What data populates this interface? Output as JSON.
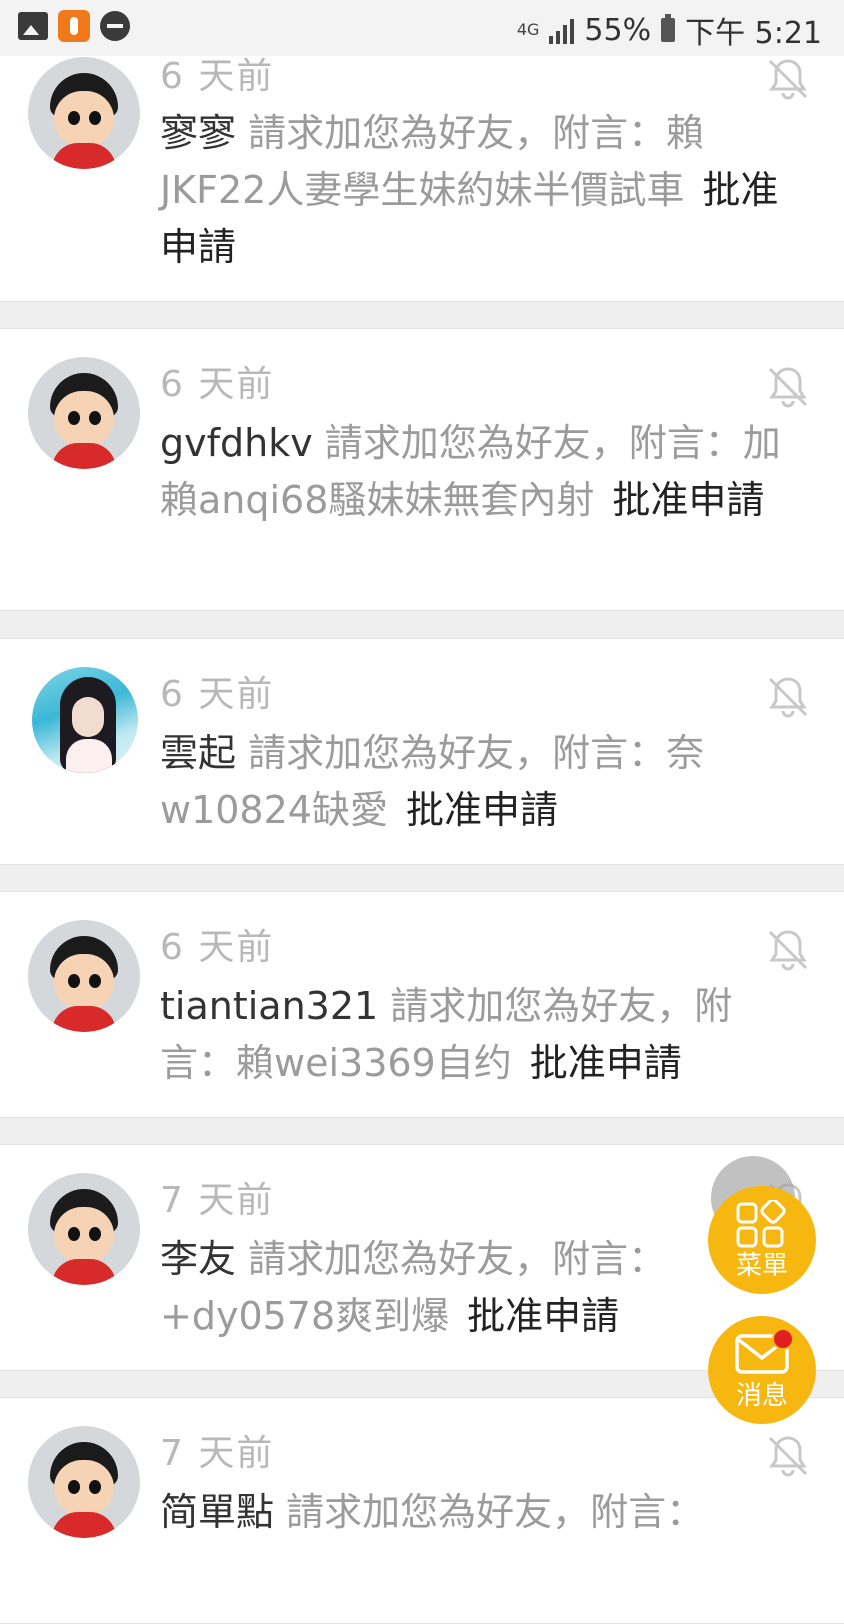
{
  "status_bar": {
    "network": "4G",
    "battery": "55%",
    "time": "下午 5:21"
  },
  "notifications": [
    {
      "time": "6 天前",
      "sender": "寥寥",
      "text": "請求加您為好友，附言：賴JKF22人妻學生妹約妹半價試車",
      "action": "批准申請",
      "avatar": "default-boy-avatar"
    },
    {
      "time": "6 天前",
      "sender": "gvfdhkv",
      "text": "請求加您為好友，附言：加賴anqi68騷妹妹無套內射",
      "action": "批准申請",
      "avatar": "default-boy-avatar"
    },
    {
      "time": "6 天前",
      "sender": "雲起",
      "text": "請求加您為好友，附言：奈w10824缺愛",
      "action": "批准申請",
      "avatar": "photo-avatar"
    },
    {
      "time": "6 天前",
      "sender": "tiantian321",
      "text": "請求加您為好友，附言：賴wei3369自约",
      "action": "批准申請",
      "avatar": "default-boy-avatar"
    },
    {
      "time": "7 天前",
      "sender": "李友",
      "text": "請求加您為好友，附言：+dy0578爽到爆",
      "action": "批准申請",
      "avatar": "default-boy-avatar"
    },
    {
      "time": "7 天前",
      "sender": "简單點",
      "text": "請求加您為好友，附言：",
      "action": "",
      "avatar": "default-boy-avatar"
    }
  ],
  "fab": {
    "menu_label": "菜單",
    "message_label": "消息"
  },
  "colors": {
    "accent": "#f6b710",
    "badge": "#e02020",
    "text_muted": "#9b9b9b",
    "text_dark": "#333333"
  }
}
